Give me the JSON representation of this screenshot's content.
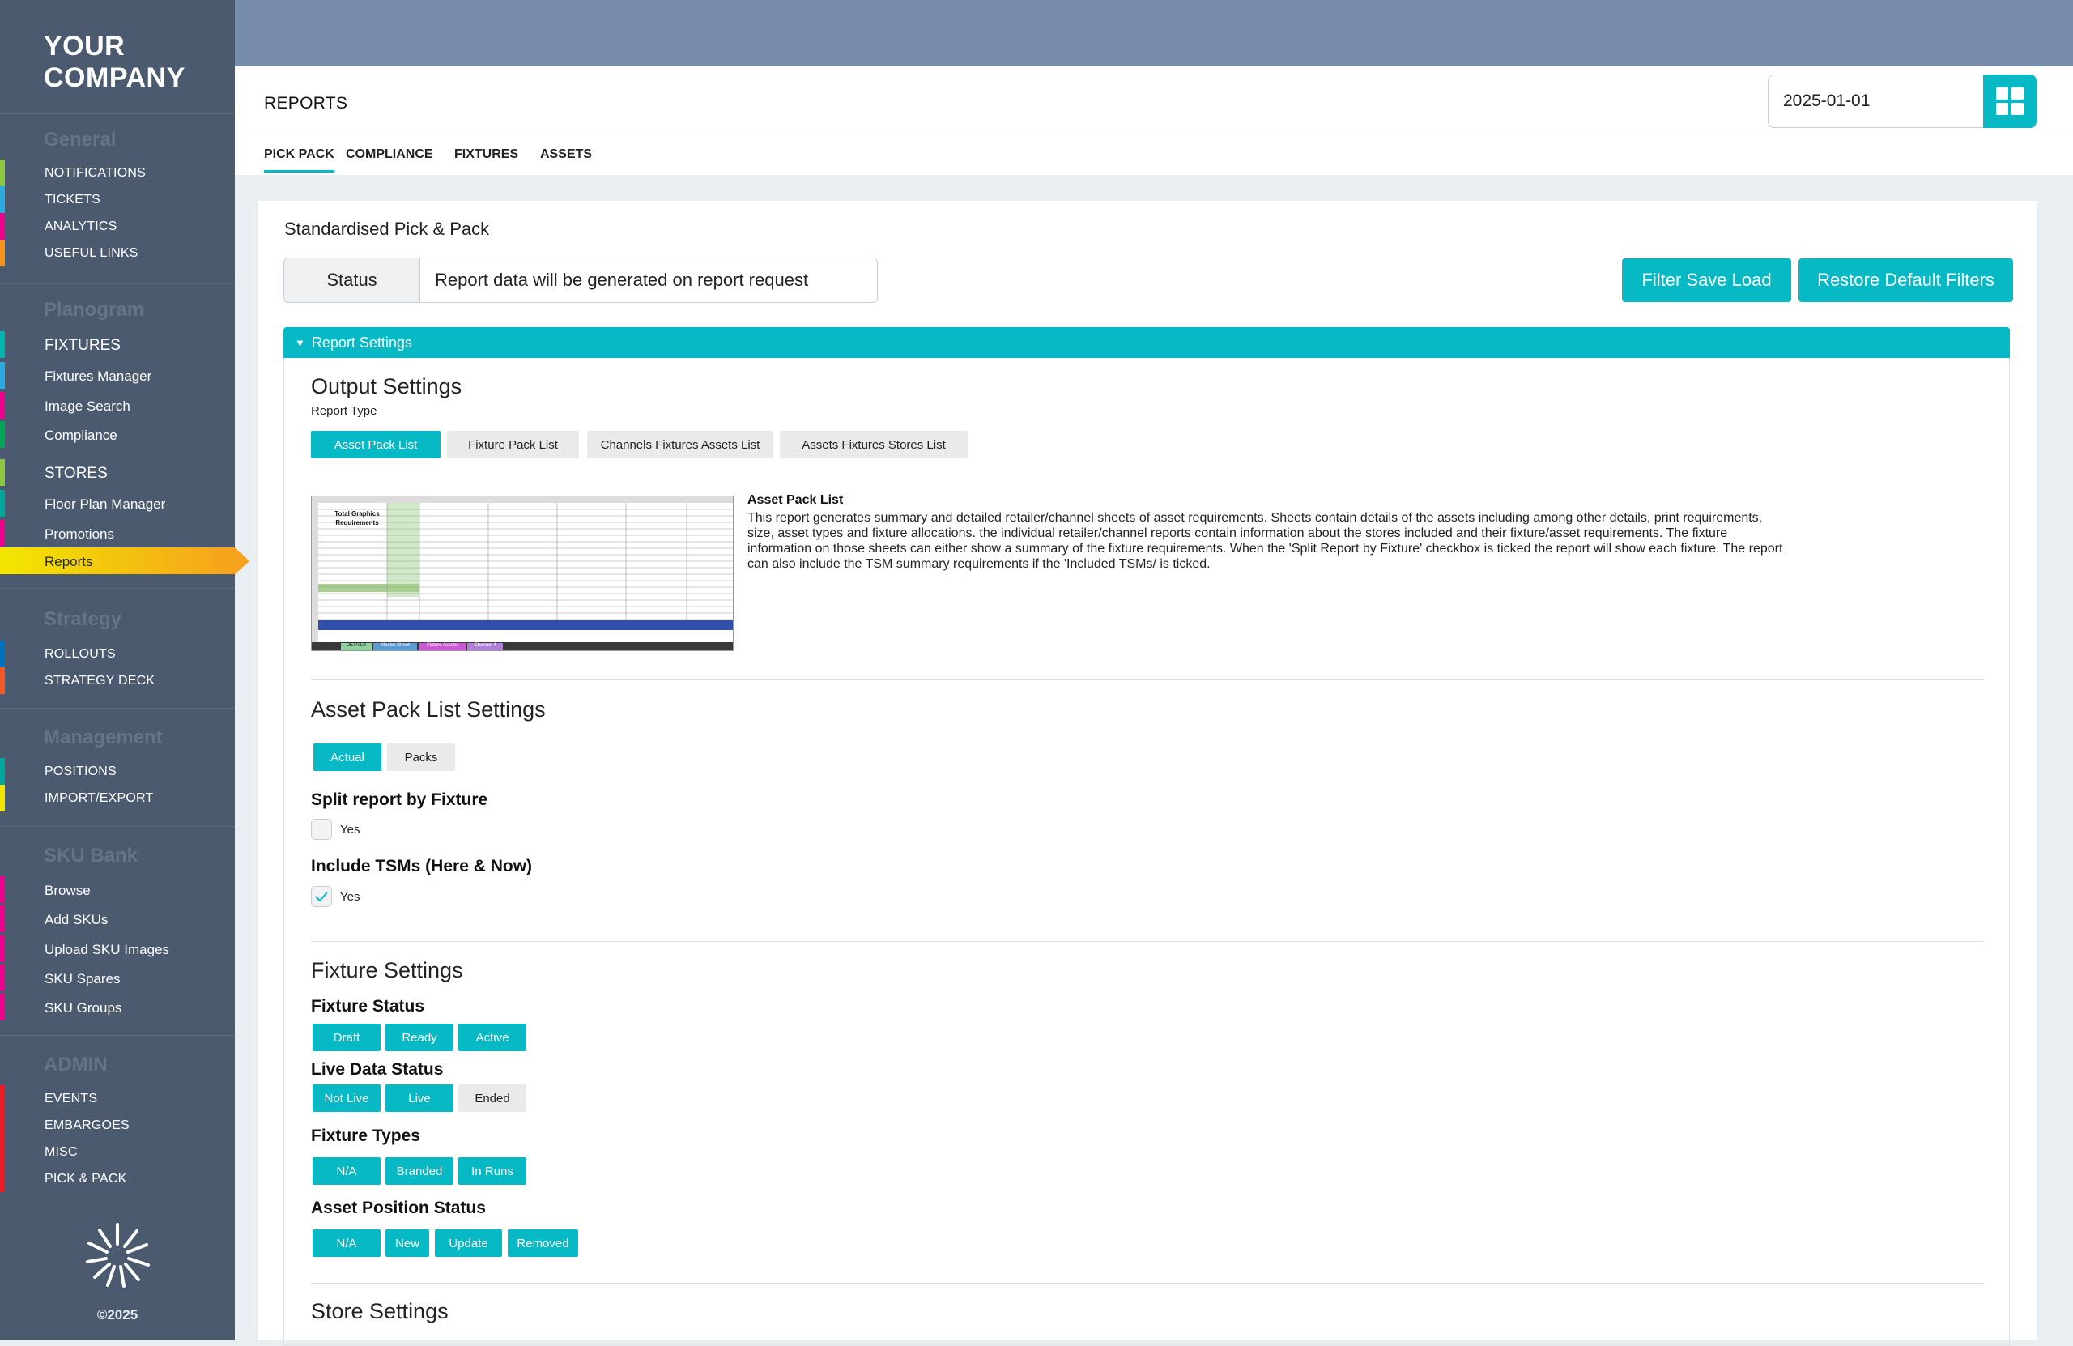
{
  "brand": {
    "line1": "YOUR",
    "line2": "COMPANY"
  },
  "sidebar": {
    "sections": [
      {
        "title": "General",
        "items": [
          {
            "label": "NOTIFICATIONS",
            "color": "#8dc63f"
          },
          {
            "label": "TICKETS",
            "color": "#29abe2"
          },
          {
            "label": "ANALYTICS",
            "color": "#ec008c"
          },
          {
            "label": "USEFUL LINKS",
            "color": "#f7941d"
          }
        ]
      },
      {
        "title": "Planogram",
        "items": [
          {
            "label": "FIXTURES",
            "color": "#00b5ad"
          },
          {
            "label": "Fixtures Manager",
            "color": "#29abe2"
          },
          {
            "label": "Image Search",
            "color": "#ec008c"
          },
          {
            "label": "Compliance",
            "color": "#00a651"
          },
          {
            "label": "STORES",
            "color": "#8dc63f"
          },
          {
            "label": "Floor Plan Manager",
            "color": "#00a99d"
          },
          {
            "label": "Promotions",
            "color": "#ec008c"
          },
          {
            "label": "Reports",
            "color": "#f2e600"
          }
        ]
      },
      {
        "title": "Strategy",
        "items": [
          {
            "label": "ROLLOUTS",
            "color": "#0071bc"
          },
          {
            "label": "STRATEGY DECK",
            "color": "#f15a24"
          }
        ]
      },
      {
        "title": "Management",
        "items": [
          {
            "label": "POSITIONS",
            "color": "#00a99d"
          },
          {
            "label": "IMPORT/EXPORT",
            "color": "#f2e600"
          }
        ]
      },
      {
        "title": "SKU Bank",
        "items": [
          {
            "label": "Browse",
            "color": "#ec008c"
          },
          {
            "label": "Add SKUs",
            "color": "#ec008c"
          },
          {
            "label": "Upload SKU Images",
            "color": "#ec008c"
          },
          {
            "label": "SKU Spares",
            "color": "#ec008c"
          },
          {
            "label": "SKU Groups",
            "color": "#ec008c"
          }
        ]
      },
      {
        "title": "ADMIN",
        "items": [
          {
            "label": "EVENTS",
            "color": "#ed1c24"
          },
          {
            "label": "EMBARGOES",
            "color": "#ed1c24"
          },
          {
            "label": "MISC",
            "color": "#ed1c24"
          },
          {
            "label": "PICK & PACK",
            "color": "#ed1c24"
          }
        ]
      }
    ],
    "active_item": "Reports",
    "copyright": "©2025"
  },
  "header": {
    "title": "REPORTS",
    "date": "2025-01-01",
    "tabs": [
      "PICK PACK",
      "COMPLIANCE",
      "FIXTURES",
      "ASSETS"
    ],
    "active_tab": "PICK PACK"
  },
  "card": {
    "title": "Standardised Pick & Pack",
    "status_label": "Status",
    "status_value": "Report data will be generated on report request",
    "filter_save_load": "Filter Save Load",
    "restore_defaults": "Restore Default Filters"
  },
  "report_settings": {
    "bar_label": "Report Settings",
    "output": {
      "title": "Output Settings",
      "report_type_label": "Report Type",
      "types": [
        "Asset Pack List",
        "Fixture Pack List",
        "Channels Fixtures Assets List",
        "Assets Fixtures Stores List"
      ],
      "selected": "Asset Pack List",
      "desc_title": "Asset Pack List",
      "desc_text": "This report generates summary and detailed retailer/channel sheets of asset requirements. Sheets contain details of the assets including among other details, print requirements, size, asset types and fixture allocations. the individual retailer/channel reports contain information about the stores included and their fixture/asset requirements. The fixture information on those sheets can either show a summary of the fixture requirements. When the 'Split Report by Fixture' checkbox is ticked the report will show each fixture. The report can also include the TSM summary requirements if the 'Included TSMs/ is ticked.",
      "thumb": {
        "heading1": "Total Graphics",
        "heading2": "Requirements",
        "tabs": [
          "DETAILS",
          "Master Sheet",
          "Fixture Assets",
          "Channel 4"
        ]
      }
    },
    "asset_pack": {
      "title": "Asset Pack List Settings",
      "modes": [
        "Actual",
        "Packs"
      ],
      "selected": "Actual",
      "split_title": "Split report by Fixture",
      "split_label": "Yes",
      "split_checked": false,
      "tsm_title": "Include TSMs (Here & Now)",
      "tsm_label": "Yes",
      "tsm_checked": true
    },
    "fixture": {
      "title": "Fixture Settings",
      "status_title": "Fixture Status",
      "status": [
        "Draft",
        "Ready",
        "Active"
      ],
      "live_title": "Live Data Status",
      "live": [
        "Not Live",
        "Live",
        "Ended"
      ],
      "types_title": "Fixture Types",
      "types": [
        "N/A",
        "Branded",
        "In Runs"
      ],
      "position_title": "Asset Position Status",
      "position": [
        "N/A",
        "New",
        "Update",
        "Removed"
      ]
    },
    "store": {
      "title": "Store Settings"
    }
  },
  "colors": {
    "accent": "#06b9c4",
    "sidebar": "#4b5a6e",
    "topbar": "#778bab"
  }
}
